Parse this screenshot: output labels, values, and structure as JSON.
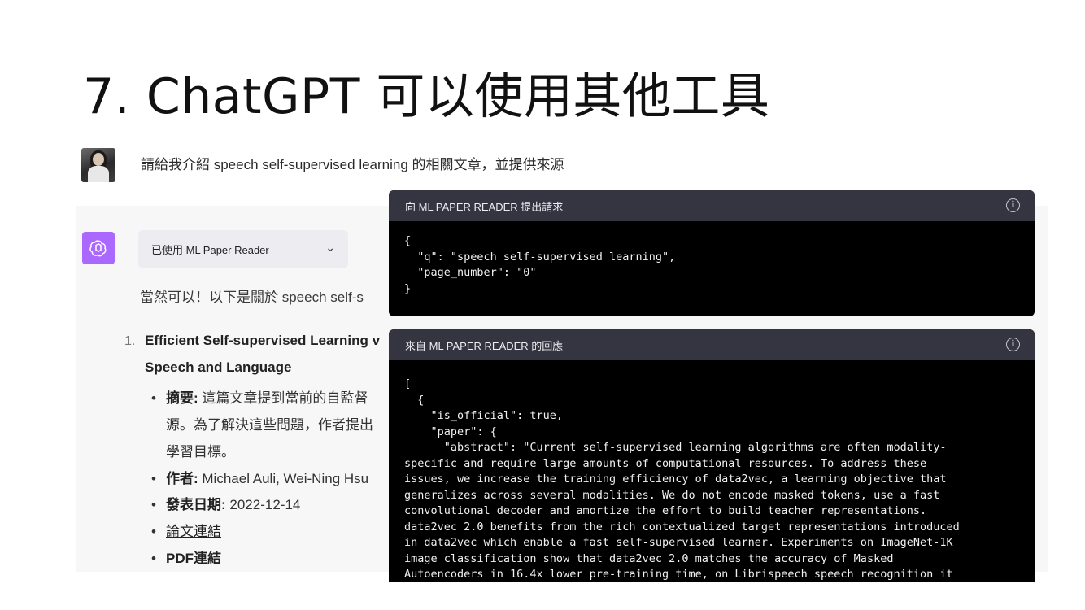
{
  "slide": {
    "title": "7. ChatGPT 可以使用其他工具"
  },
  "user": {
    "message": "請給我介紹 speech self-supervised learning 的相關文章，並提供來源"
  },
  "assistant": {
    "plugin_status": "已使用 ML Paper Reader",
    "intro": "當然可以！以下是關於 speech self-s",
    "items": [
      {
        "number": "1.",
        "title_line1": "Efficient Self-supervised Learning v",
        "title_line2": "Speech and Language",
        "summary_label": "摘要:",
        "summary_line1": " 這篇文章提到當前的自監督",
        "summary_line2": "源。為了解決這些問題，作者提出",
        "summary_line3": "學習目標。",
        "authors_label": "作者:",
        "authors": " Michael Auli, Wei-Ning Hsu",
        "date_label": "發表日期:",
        "date": " 2022-12-14",
        "paper_link": "論文連結",
        "pdf_link": "PDF連結"
      }
    ]
  },
  "request_card": {
    "header": "向 ML PAPER READER 提出請求",
    "body": "{\n  \"q\": \"speech self-supervised learning\",\n  \"page_number\": \"0\"\n}"
  },
  "response_card": {
    "header": "來自 ML PAPER READER 的回應",
    "body": "[\n  {\n    \"is_official\": true,\n    \"paper\": {\n      \"abstract\": \"Current self-supervised learning algorithms are often modality-\nspecific and require large amounts of computational resources. To address these\nissues, we increase the training efficiency of data2vec, a learning objective that\ngeneralizes across several modalities. We do not encode masked tokens, use a fast\nconvolutional decoder and amortize the effort to build teacher representations.\ndata2vec 2.0 benefits from the rich contextualized target representations introduced\nin data2vec which enable a fast self-supervised learner. Experiments on ImageNet-1K\nimage classification show that data2vec 2.0 matches the accuracy of Masked\nAutoencoders in 16.4x lower pre-training time, on Librispeech speech recognition it"
  },
  "icons": {
    "gpt": "openai-logo-icon",
    "info": "info-icon",
    "chevron": "chevron-down-icon"
  },
  "colors": {
    "gpt_icon_bg": "#ab68ff",
    "card_header_bg": "#343541",
    "card_bg": "#000000",
    "assistant_bg": "#f7f7f8"
  }
}
